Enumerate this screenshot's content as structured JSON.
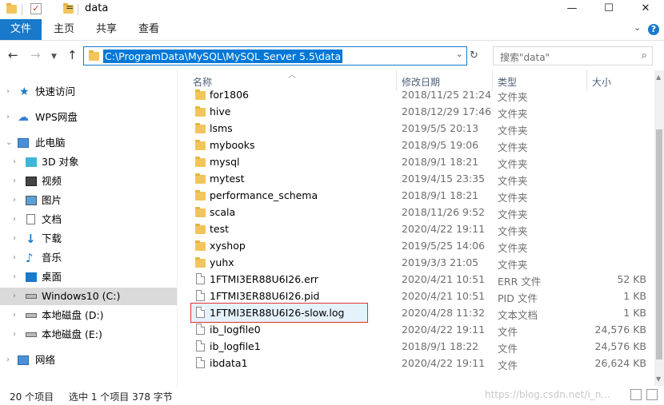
{
  "window": {
    "title": "data",
    "qat_dropdown": "=",
    "controls": {
      "minimize": "—",
      "maximize": "☐",
      "close": "✕"
    }
  },
  "ribbon": {
    "tabs": [
      {
        "label": "文件"
      },
      {
        "label": "主页"
      },
      {
        "label": "共享"
      },
      {
        "label": "查看"
      }
    ],
    "collapse": "⌄",
    "help": "?"
  },
  "address": {
    "path": "C:\\ProgramData\\MySQL\\MySQL Server 5.5\\data",
    "dropdown": "⌄"
  },
  "search": {
    "placeholder": "搜索\"data\""
  },
  "nav": {
    "items": [
      {
        "label": "快速访问",
        "icon": "star-icon"
      },
      {
        "label": "WPS网盘",
        "icon": "cloud-icon"
      },
      {
        "label": "此电脑",
        "icon": "computer-icon"
      },
      {
        "label": "3D 对象",
        "icon": "cube-icon"
      },
      {
        "label": "视频",
        "icon": "video-icon"
      },
      {
        "label": "图片",
        "icon": "picture-icon"
      },
      {
        "label": "文档",
        "icon": "document-icon"
      },
      {
        "label": "下载",
        "icon": "download-icon"
      },
      {
        "label": "音乐",
        "icon": "music-icon"
      },
      {
        "label": "桌面",
        "icon": "desktop-icon"
      },
      {
        "label": "Windows10 (C:)",
        "icon": "drive-icon"
      },
      {
        "label": "本地磁盘 (D:)",
        "icon": "drive-icon"
      },
      {
        "label": "本地磁盘 (E:)",
        "icon": "drive-icon"
      },
      {
        "label": "网络",
        "icon": "network-icon"
      }
    ]
  },
  "columns": {
    "name": "名称",
    "date": "修改日期",
    "type": "类型",
    "size": "大小"
  },
  "files": [
    {
      "name": "for1806",
      "date": "2018/11/25 21:24",
      "type": "文件夹",
      "size": "",
      "kind": "folder"
    },
    {
      "name": "hive",
      "date": "2018/12/29 17:46",
      "type": "文件夹",
      "size": "",
      "kind": "folder"
    },
    {
      "name": "lsms",
      "date": "2019/5/5 20:13",
      "type": "文件夹",
      "size": "",
      "kind": "folder"
    },
    {
      "name": "mybooks",
      "date": "2018/9/5 19:06",
      "type": "文件夹",
      "size": "",
      "kind": "folder"
    },
    {
      "name": "mysql",
      "date": "2018/9/1 18:21",
      "type": "文件夹",
      "size": "",
      "kind": "folder"
    },
    {
      "name": "mytest",
      "date": "2019/4/15 23:35",
      "type": "文件夹",
      "size": "",
      "kind": "folder"
    },
    {
      "name": "performance_schema",
      "date": "2018/9/1 18:21",
      "type": "文件夹",
      "size": "",
      "kind": "folder"
    },
    {
      "name": "scala",
      "date": "2018/11/26 9:52",
      "type": "文件夹",
      "size": "",
      "kind": "folder"
    },
    {
      "name": "test",
      "date": "2020/4/22 19:11",
      "type": "文件夹",
      "size": "",
      "kind": "folder"
    },
    {
      "name": "xyshop",
      "date": "2019/5/25 14:06",
      "type": "文件夹",
      "size": "",
      "kind": "folder"
    },
    {
      "name": "yuhx",
      "date": "2019/3/3 21:05",
      "type": "文件夹",
      "size": "",
      "kind": "folder"
    },
    {
      "name": "1FTMI3ER88U6I26.err",
      "date": "2020/4/21 10:51",
      "type": "ERR 文件",
      "size": "52 KB",
      "kind": "file"
    },
    {
      "name": "1FTMI3ER88U6I26.pid",
      "date": "2020/4/21 10:51",
      "type": "PID 文件",
      "size": "1 KB",
      "kind": "file"
    },
    {
      "name": "1FTMI3ER88U6I26-slow.log",
      "date": "2020/4/28 11:32",
      "type": "文本文档",
      "size": "1 KB",
      "kind": "file",
      "selected": true
    },
    {
      "name": "ib_logfile0",
      "date": "2020/4/22 19:11",
      "type": "文件",
      "size": "24,576 KB",
      "kind": "file"
    },
    {
      "name": "ib_logfile1",
      "date": "2018/9/1 18:22",
      "type": "文件",
      "size": "24,576 KB",
      "kind": "file"
    },
    {
      "name": "ibdata1",
      "date": "2020/4/22 19:11",
      "type": "文件",
      "size": "26,624 KB",
      "kind": "file"
    }
  ],
  "status": {
    "count": "20 个项目",
    "selection": "选中 1 个项目  378 字节",
    "watermark": "https://blog.csdn.net/i_n..."
  },
  "colors": {
    "accent": "#1979ca",
    "selection_outline": "#d33333",
    "folder": "#f2c55c"
  }
}
